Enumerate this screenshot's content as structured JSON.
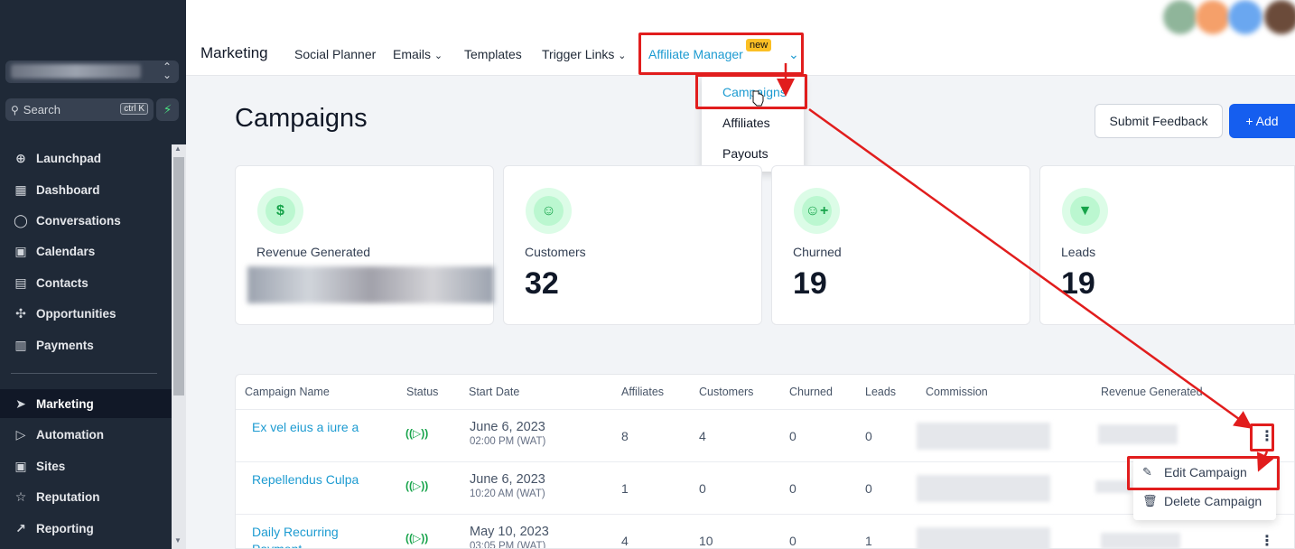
{
  "sidebar": {
    "search": {
      "placeholder": "Search",
      "shortcut": "ctrl K"
    },
    "items": [
      {
        "label": "Launchpad",
        "icon": "rocket-icon",
        "glyph": "⊕"
      },
      {
        "label": "Dashboard",
        "icon": "grid-icon",
        "glyph": "▦"
      },
      {
        "label": "Conversations",
        "icon": "chat-icon",
        "glyph": "◯"
      },
      {
        "label": "Calendars",
        "icon": "calendar-icon",
        "glyph": "▣"
      },
      {
        "label": "Contacts",
        "icon": "contacts-icon",
        "glyph": "▤"
      },
      {
        "label": "Opportunities",
        "icon": "network-icon",
        "glyph": "✣"
      },
      {
        "label": "Payments",
        "icon": "payments-icon",
        "glyph": "▥"
      },
      {
        "label": "Marketing",
        "icon": "send-icon",
        "glyph": "➤"
      },
      {
        "label": "Automation",
        "icon": "automation-icon",
        "glyph": "▷"
      },
      {
        "label": "Sites",
        "icon": "sites-icon",
        "glyph": "▣"
      },
      {
        "label": "Reputation",
        "icon": "star-icon",
        "glyph": "☆"
      },
      {
        "label": "Reporting",
        "icon": "trend-icon",
        "glyph": "↗"
      }
    ]
  },
  "topbar": {
    "brand": "Marketing",
    "nav": [
      "Social Planner",
      "Emails",
      "Templates",
      "Trigger Links",
      "Affiliate Manager"
    ],
    "new_badge": "new",
    "dropdown": [
      "Campaigns",
      "Affiliates",
      "Payouts"
    ]
  },
  "page": {
    "title": "Campaigns",
    "feedback_button": "Submit Feedback",
    "add_button": "+ Add"
  },
  "stats": [
    {
      "label": "Revenue Generated",
      "value": "",
      "icon": "dollar-icon",
      "glyph": "$"
    },
    {
      "label": "Customers",
      "value": "32",
      "icon": "user-icon",
      "glyph": "☺"
    },
    {
      "label": "Churned",
      "value": "19",
      "icon": "user-plus-icon",
      "glyph": "☺+"
    },
    {
      "label": "Leads",
      "value": "19",
      "icon": "funnel-icon",
      "glyph": "▼"
    }
  ],
  "table": {
    "columns": [
      "Campaign Name",
      "Status",
      "Start Date",
      "Affiliates",
      "Customers",
      "Churned",
      "Leads",
      "Commission",
      "Revenue Generated"
    ],
    "rows": [
      {
        "name": "Ex vel eius a iure a",
        "date": "June 6, 2023",
        "time": "02:00 PM (WAT)",
        "affiliates": "8",
        "customers": "4",
        "churned": "0",
        "leads": "0"
      },
      {
        "name": "Repellendus Culpa",
        "date": "June 6, 2023",
        "time": "10:20 AM (WAT)",
        "affiliates": "1",
        "customers": "0",
        "churned": "0",
        "leads": "0"
      },
      {
        "name": "Daily Recurring Payment",
        "date": "May 10, 2023",
        "time": "03:05 PM (WAT)",
        "affiliates": "4",
        "customers": "10",
        "churned": "0",
        "leads": "1"
      }
    ]
  },
  "row_menu": [
    "Edit Campaign",
    "Delete Campaign"
  ],
  "colors": {
    "sidebar": "#1f2937",
    "accent": "#155eef",
    "link": "#1d9bd1",
    "annotation": "#e11d1d",
    "success": "#16a34a"
  }
}
